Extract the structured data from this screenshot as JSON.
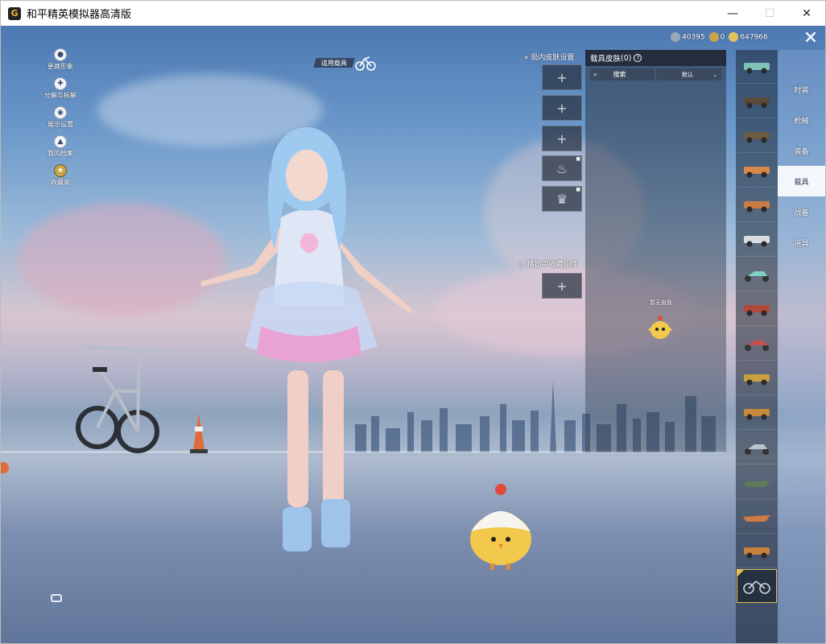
{
  "window": {
    "title": "和平精英模拟器高清版",
    "app_icon": "G",
    "controls": [
      "—",
      "☐",
      "✕"
    ]
  },
  "left_menu": [
    {
      "label": "更换形象",
      "icon": "person-icon"
    },
    {
      "label": "分解与拆解",
      "icon": "puzzle-icon"
    },
    {
      "label": "展示设置",
      "icon": "eye-icon"
    },
    {
      "label": "我的档案",
      "icon": "flame-icon"
    },
    {
      "label": "收藏家",
      "icon": "badge-icon"
    }
  ],
  "used_vehicle_label": "适用载具",
  "currency": [
    {
      "value": "40395",
      "color": "#9aa7b8"
    },
    {
      "value": "0",
      "color": "#c9a548"
    },
    {
      "value": "647966",
      "color": "#e2c35b"
    }
  ],
  "skin_settings": {
    "title": "局内皮肤设置",
    "slots": [
      "+",
      "+",
      "+",
      "♨",
      "♛"
    ],
    "broadcast_title": "播出中收藏组件",
    "broadcast_slot": "+"
  },
  "vehicle_skin_panel": {
    "title": "载具皮肤",
    "count": "(0)",
    "help": "?",
    "search_label": "搜索",
    "sort_label": "默认",
    "no_skin_label": "暂无皮肤"
  },
  "vehicles": [
    {
      "name": "minibus",
      "color": "#7fc3b8"
    },
    {
      "name": "jeep-dark",
      "color": "#5a4a3a"
    },
    {
      "name": "jeep-brown",
      "color": "#6b5a44"
    },
    {
      "name": "sedan-orange",
      "color": "#d8884a"
    },
    {
      "name": "sedan-orange-2",
      "color": "#c97c44"
    },
    {
      "name": "pickup-white",
      "color": "#d8dde2"
    },
    {
      "name": "scooter",
      "color": "#7fd1c1"
    },
    {
      "name": "atv-red",
      "color": "#b04a3a"
    },
    {
      "name": "snowmobile",
      "color": "#c74f4f"
    },
    {
      "name": "buggy-yellow",
      "color": "#c8a040"
    },
    {
      "name": "tuktuk",
      "color": "#c88a3a"
    },
    {
      "name": "motorbike",
      "color": "#b9c4cf"
    },
    {
      "name": "boat-green",
      "color": "#5e7a58"
    },
    {
      "name": "boat-orange",
      "color": "#d17a44"
    },
    {
      "name": "atv-orange",
      "color": "#c8803a"
    },
    {
      "name": "bicycle",
      "color": "#cfd6dd"
    }
  ],
  "categories": [
    {
      "label": "时装",
      "active": false
    },
    {
      "label": "枪械",
      "active": false
    },
    {
      "label": "装备",
      "active": false
    },
    {
      "label": "载具",
      "active": true
    },
    {
      "label": "战备",
      "active": false
    },
    {
      "label": "道具",
      "active": false
    }
  ]
}
